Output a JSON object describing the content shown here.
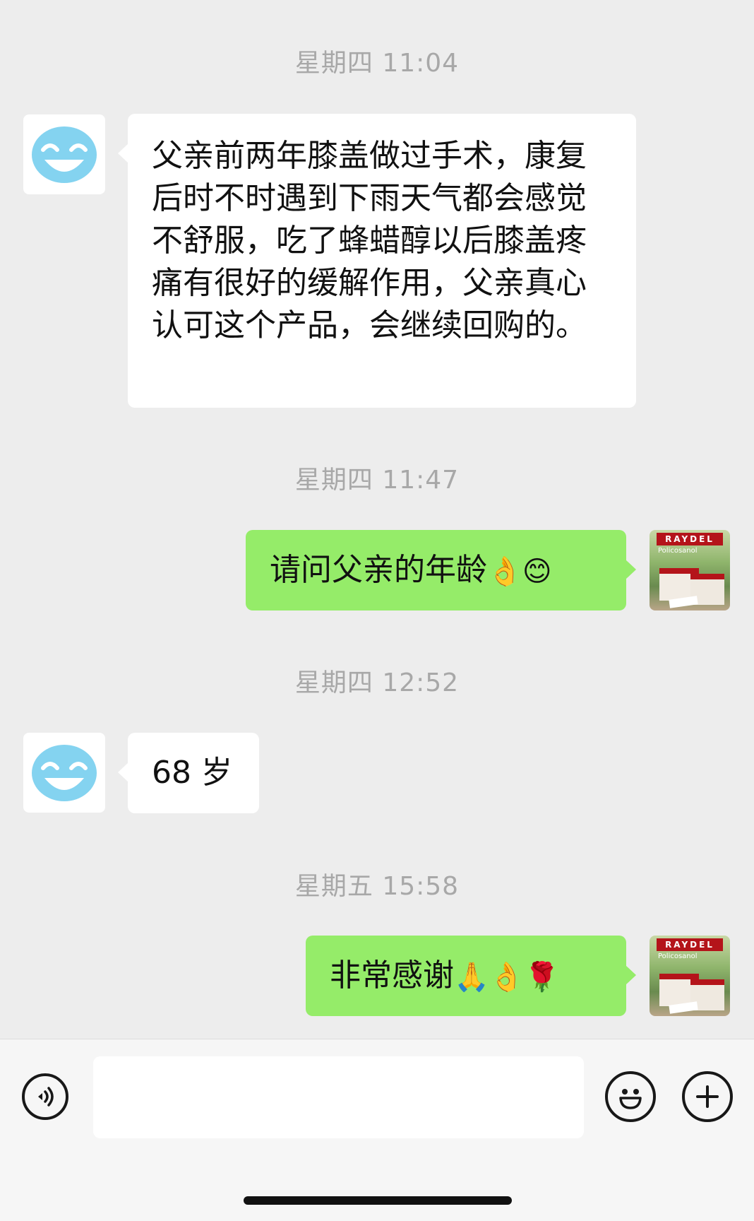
{
  "messages": [
    {
      "type": "timestamp",
      "text": "星期四 11:04"
    },
    {
      "type": "incoming",
      "text": "父亲前两年膝盖做过手术，康复后时不时遇到下雨天气都会感觉不舒服，吃了蜂蜡醇以后膝盖疼痛有很好的缓解作用，父亲真心认可这个产品，会继续回购的。"
    },
    {
      "type": "timestamp",
      "text": "星期四 11:47"
    },
    {
      "type": "outgoing",
      "text": "请问父亲的年龄",
      "emojis": [
        "👌",
        "😊"
      ]
    },
    {
      "type": "timestamp",
      "text": "星期四 12:52"
    },
    {
      "type": "incoming",
      "text": "68 岁"
    },
    {
      "type": "timestamp",
      "text": "星期五 15:58"
    },
    {
      "type": "outgoing",
      "text": "非常感谢",
      "emojis": [
        "🙏",
        "👌",
        "🌹"
      ]
    }
  ],
  "thumbnail": {
    "brand": "RAYDEL",
    "sub": "Policosanol"
  },
  "colors": {
    "background": "#ededed",
    "outgoing_bubble": "#95ec69",
    "incoming_bubble": "#ffffff",
    "avatar_face": "#84d3f0"
  },
  "icons": {
    "voice": "voice-input-icon",
    "emoji": "emoji-icon",
    "plus": "plus-icon",
    "avatar": "smile-face-icon"
  }
}
